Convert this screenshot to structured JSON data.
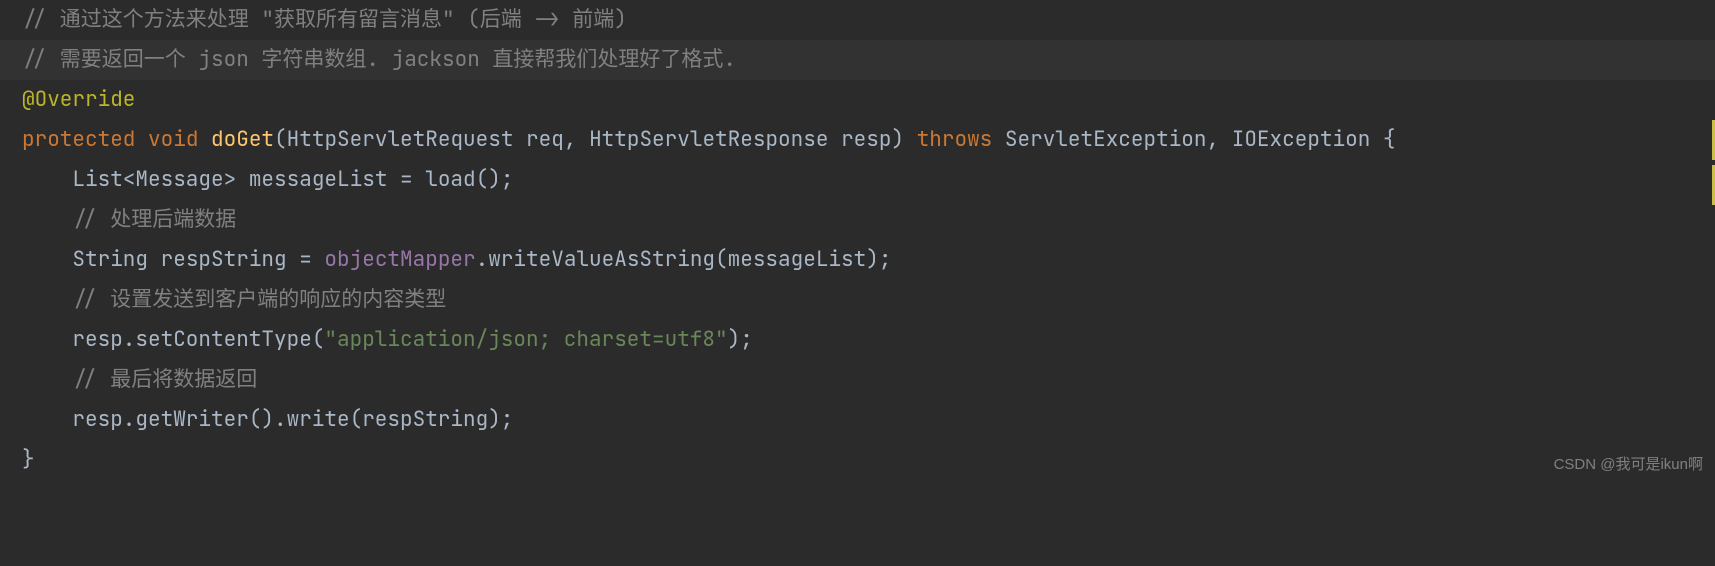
{
  "code": {
    "line1_comment": "// 通过这个方法来处理 \"获取所有留言消息\" (后端 -> 前端)",
    "line2_comment": "// 需要返回一个 json 字符串数组. jackson 直接帮我们处理好了格式.",
    "annotation": "@Override",
    "kw_protected": "protected",
    "kw_void": "void",
    "method_name": "doGet",
    "param_open": "(",
    "param_type1": "HttpServletRequest",
    "param_name1": " req",
    "comma1": ", ",
    "param_type2": "HttpServletResponse",
    "param_name2": " resp",
    "param_close": ")",
    "kw_throws": "throws",
    "exc1": "ServletException",
    "comma2": ", ",
    "exc2": "IOException",
    "brace_open": " {",
    "indent1": "    ",
    "list_decl_type": "List<Message>",
    "list_decl_rest": " messageList = load();",
    "comment_proc": "// 处理后端数据",
    "str_decl_type": "String",
    "str_decl_mid": " respString = ",
    "objmapper": "objectMapper",
    "write_call": ".writeValueAsString(messageList);",
    "comment_ct": "// 设置发送到客户端的响应的内容类型",
    "resp_ct_pre": "resp.setContentType(",
    "ct_string": "\"application/json; charset=utf8\"",
    "resp_ct_post": ");",
    "comment_ret": "// 最后将数据返回",
    "resp_write": "resp.getWriter().write(respString);",
    "brace_close": "}"
  },
  "watermark": "CSDN @我可是ikun啊"
}
